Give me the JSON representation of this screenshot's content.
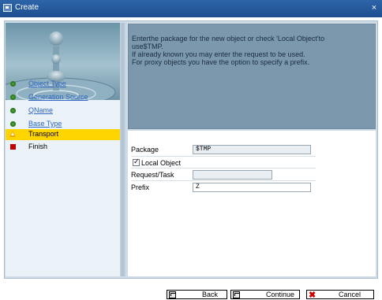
{
  "window": {
    "title": "Create",
    "close_symbol": "×"
  },
  "info": {
    "lines": [
      "Enterthe package for the new object or check 'Local Object'to",
      "use$TMP.",
      "If already known you may enter the request to be used.",
      "For proxy objects you have the option to specify a prefix."
    ]
  },
  "steps": [
    {
      "label": "Object Type",
      "status": "done",
      "icon": "green-dot-icon"
    },
    {
      "label": "Generation Source",
      "status": "done",
      "icon": "green-dot-icon"
    },
    {
      "label": "QName",
      "status": "done",
      "icon": "green-dot-icon"
    },
    {
      "label": "Base Type",
      "status": "done",
      "icon": "green-dot-icon"
    },
    {
      "label": "Transport",
      "status": "current",
      "icon": "warning-triangle-icon"
    },
    {
      "label": "Finish",
      "status": "pending",
      "icon": "red-square-icon"
    }
  ],
  "form": {
    "package_label": "Package",
    "package_value": "$TMP",
    "local_object_label": "Local Object",
    "local_object_checked": true,
    "request_label": "Request/Task",
    "request_value": "",
    "prefix_label": "Prefix",
    "prefix_value": "Z"
  },
  "buttons": {
    "back": "Back",
    "continue": "Continue",
    "cancel": "Cancel"
  },
  "colors": {
    "titlebar": "#1d4f90",
    "current_step": "#ffd500",
    "link": "#2f66c2",
    "info_panel": "#7b98ad"
  }
}
